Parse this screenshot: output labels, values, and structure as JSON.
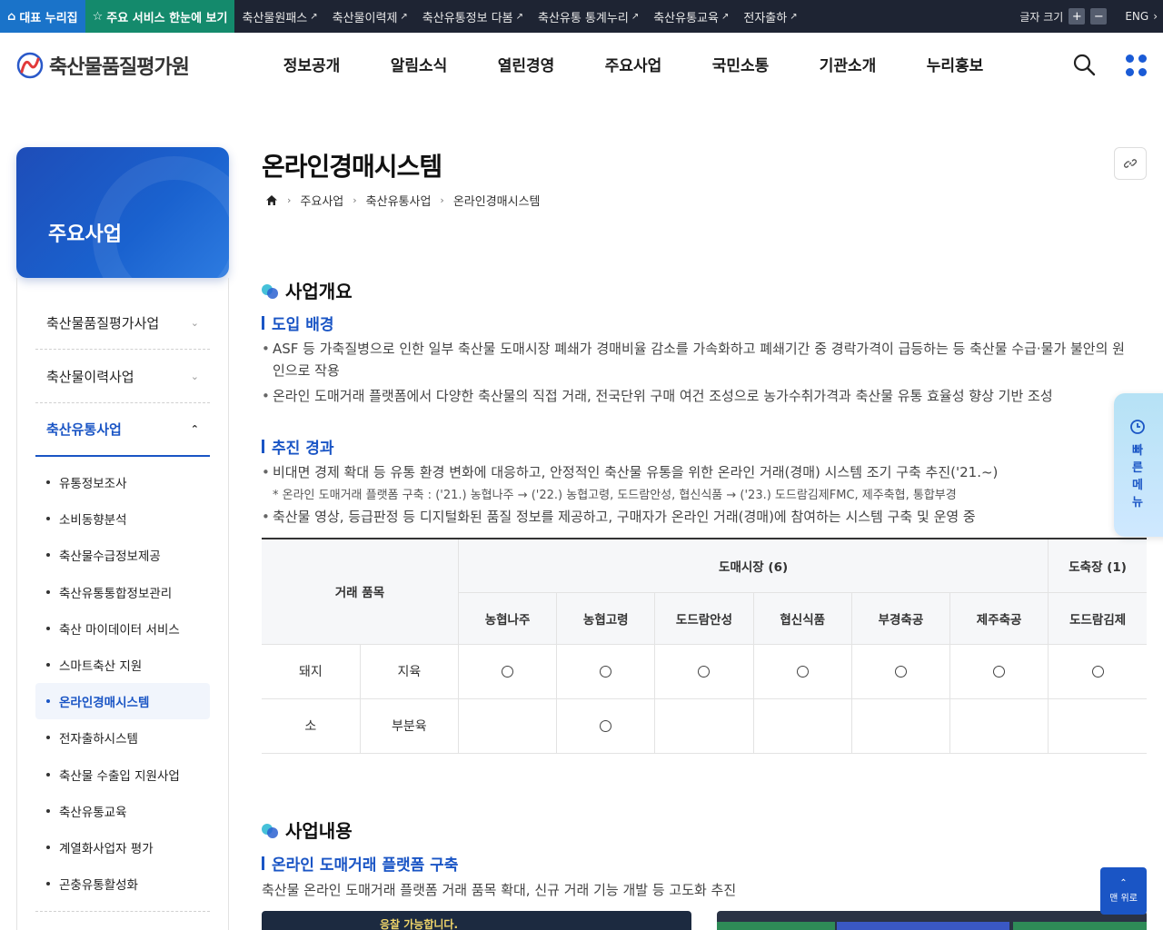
{
  "utilbar": {
    "home_label": "대표 누리집",
    "star_label": "주요 서비스 한눈에 보기",
    "links": [
      "축산물원패스",
      "축산물이력제",
      "축산유통정보 다봄",
      "축산유통 통계누리",
      "축산유통교육",
      "전자출하"
    ],
    "font_size_label": "글자 크기",
    "plus": "+",
    "minus": "−",
    "lang_label": "ENG"
  },
  "header": {
    "logo_text": "축산물품질평가원",
    "nav": [
      "정보공개",
      "알림소식",
      "열린경영",
      "주요사업",
      "국민소통",
      "기관소개",
      "누리홍보"
    ]
  },
  "lnb": {
    "title": "주요사업",
    "dep1": [
      "축산물품질평가사업",
      "축산물이력사업",
      "축산유통사업"
    ],
    "dep2": [
      "유통정보조사",
      "소비동향분석",
      "축산물수급정보제공",
      "축산유통통합정보관리",
      "축산 마이데이터 서비스",
      "스마트축산 지원",
      "온라인경매시스템",
      "전자출하시스템",
      "축산물 수출입 지원사업",
      "축산유통교육",
      "계열화사업자 평가",
      "곤충유통활성화"
    ]
  },
  "page": {
    "title": "온라인경매시스템",
    "breadcrumb": [
      "주요사업",
      "축산유통사업",
      "온라인경매시스템"
    ]
  },
  "section1": {
    "title": "사업개요",
    "sub1": "도입 배경",
    "sub1_bullets": [
      "ASF 등 가축질병으로 인한 일부 축산물 도매시장 폐쇄가 경매비율 감소를 가속화하고 폐쇄기간 중 경락가격이 급등하는 등 축산물 수급·물가 불안의 원인으로 작용",
      "온라인 도매거래 플랫폼에서 다양한 축산물의 직접 거래, 전국단위 구매 여건 조성으로 농가수취가격과 축산물 유통 효율성 향상 기반 조성"
    ],
    "sub2": "추진 경과",
    "sub2_bullet1": "비대면 경제 확대 등 유통 환경 변화에 대응하고, 안정적인 축산물 유통을 위한 온라인 거래(경매) 시스템 조기 구축 추진('21.~)",
    "sub2_note": "* 온라인 도매거래 플랫폼 구축 : ('21.) 농협나주 → ('22.) 농협고령, 도드람안성, 협신식품 → ('23.) 도드람김제FMC, 제주축협, 통합부경",
    "sub2_bullet2": "축산물 영상, 등급판정 등 디지털화된 품질 정보를 제공하고, 구매자가 온라인 거래(경매)에 참여하는 시스템 구축 및 운영 중"
  },
  "table": {
    "head_item": "거래 품목",
    "head_market": "도매시장 (6)",
    "head_slaughter": "도축장 (1)",
    "columns": [
      "농협나주",
      "농협고령",
      "도드람안성",
      "협신식품",
      "부경축공",
      "제주축공",
      "도드람김제"
    ],
    "rows": [
      {
        "kind": "돼지",
        "type": "지육",
        "marks": [
          true,
          true,
          true,
          true,
          true,
          true,
          true
        ]
      },
      {
        "kind": "소",
        "type": "부분육",
        "marks": [
          false,
          true,
          false,
          false,
          false,
          false,
          false
        ]
      }
    ]
  },
  "section2": {
    "title": "사업내용",
    "sub1": "온라인 도매거래 플랫폼 구축",
    "desc": "축산물 온라인 도매거래 플랫폼 거래 품목 확대, 신규 거래 기능 개발 등 고도화 추진",
    "shot1_text": "응찰 가능합니다."
  },
  "floating": {
    "quick_menu": "빠른메뉴",
    "top_label": "맨 위로"
  }
}
